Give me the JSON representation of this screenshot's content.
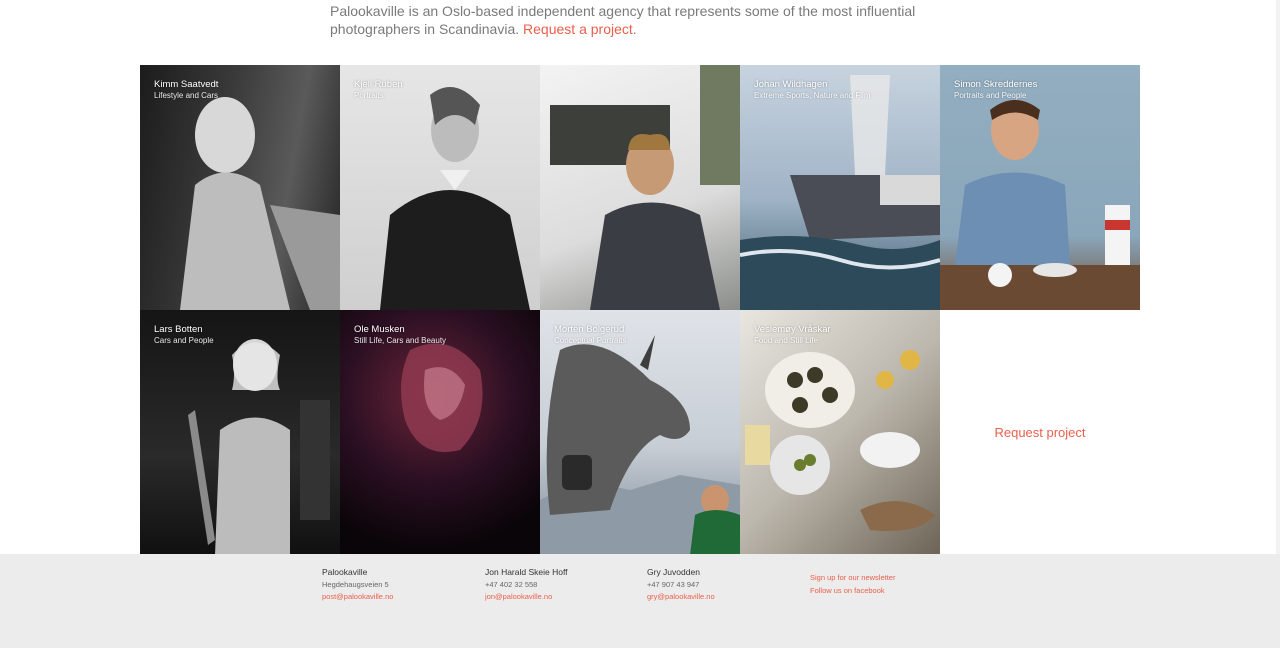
{
  "intro": {
    "text": "Palookaville is an Oslo-based independent agency that represents some of the most influential photographers in Scandinavia.",
    "link": "Request a project",
    "after": "."
  },
  "photographers": [
    {
      "name": "Kimm Saatvedt",
      "category": "Lifestyle and Cars"
    },
    {
      "name": "Kjell Ruben",
      "category": "Portraits"
    },
    {
      "name": "",
      "category": ""
    },
    {
      "name": "Johan Wildhagen",
      "category": "Extreme Sports, Nature and Film"
    },
    {
      "name": "Simon Skreddernes",
      "category": "Portraits and People"
    },
    {
      "name": "Lars Botten",
      "category": "Cars and People"
    },
    {
      "name": "Ole Musken",
      "category": "Still Life, Cars and Beauty"
    },
    {
      "name": "Morten Bolgerud",
      "category": "Conceptual Portraits"
    },
    {
      "name": "Veslemøy Vråskar",
      "category": "Food and Still Life"
    }
  ],
  "request_tile": {
    "label": "Request project"
  },
  "footer": {
    "company": {
      "name": "Palookaville",
      "address": "Hegdehaugsveien 5",
      "email": "post@palookaville.no"
    },
    "contact1": {
      "name": "Jon Harald Skeie Hoff",
      "phone": "+47 402 32 558",
      "email": "jon@palookaville.no"
    },
    "contact2": {
      "name": "Gry Juvodden",
      "phone": "+47 907 43 947",
      "email": "gry@palookaville.no"
    },
    "links": {
      "newsletter": "Sign up for our newsletter",
      "facebook": "Follow us on facebook"
    }
  },
  "colors": {
    "accent": "#e8604c",
    "footer_bg": "#ececec"
  }
}
